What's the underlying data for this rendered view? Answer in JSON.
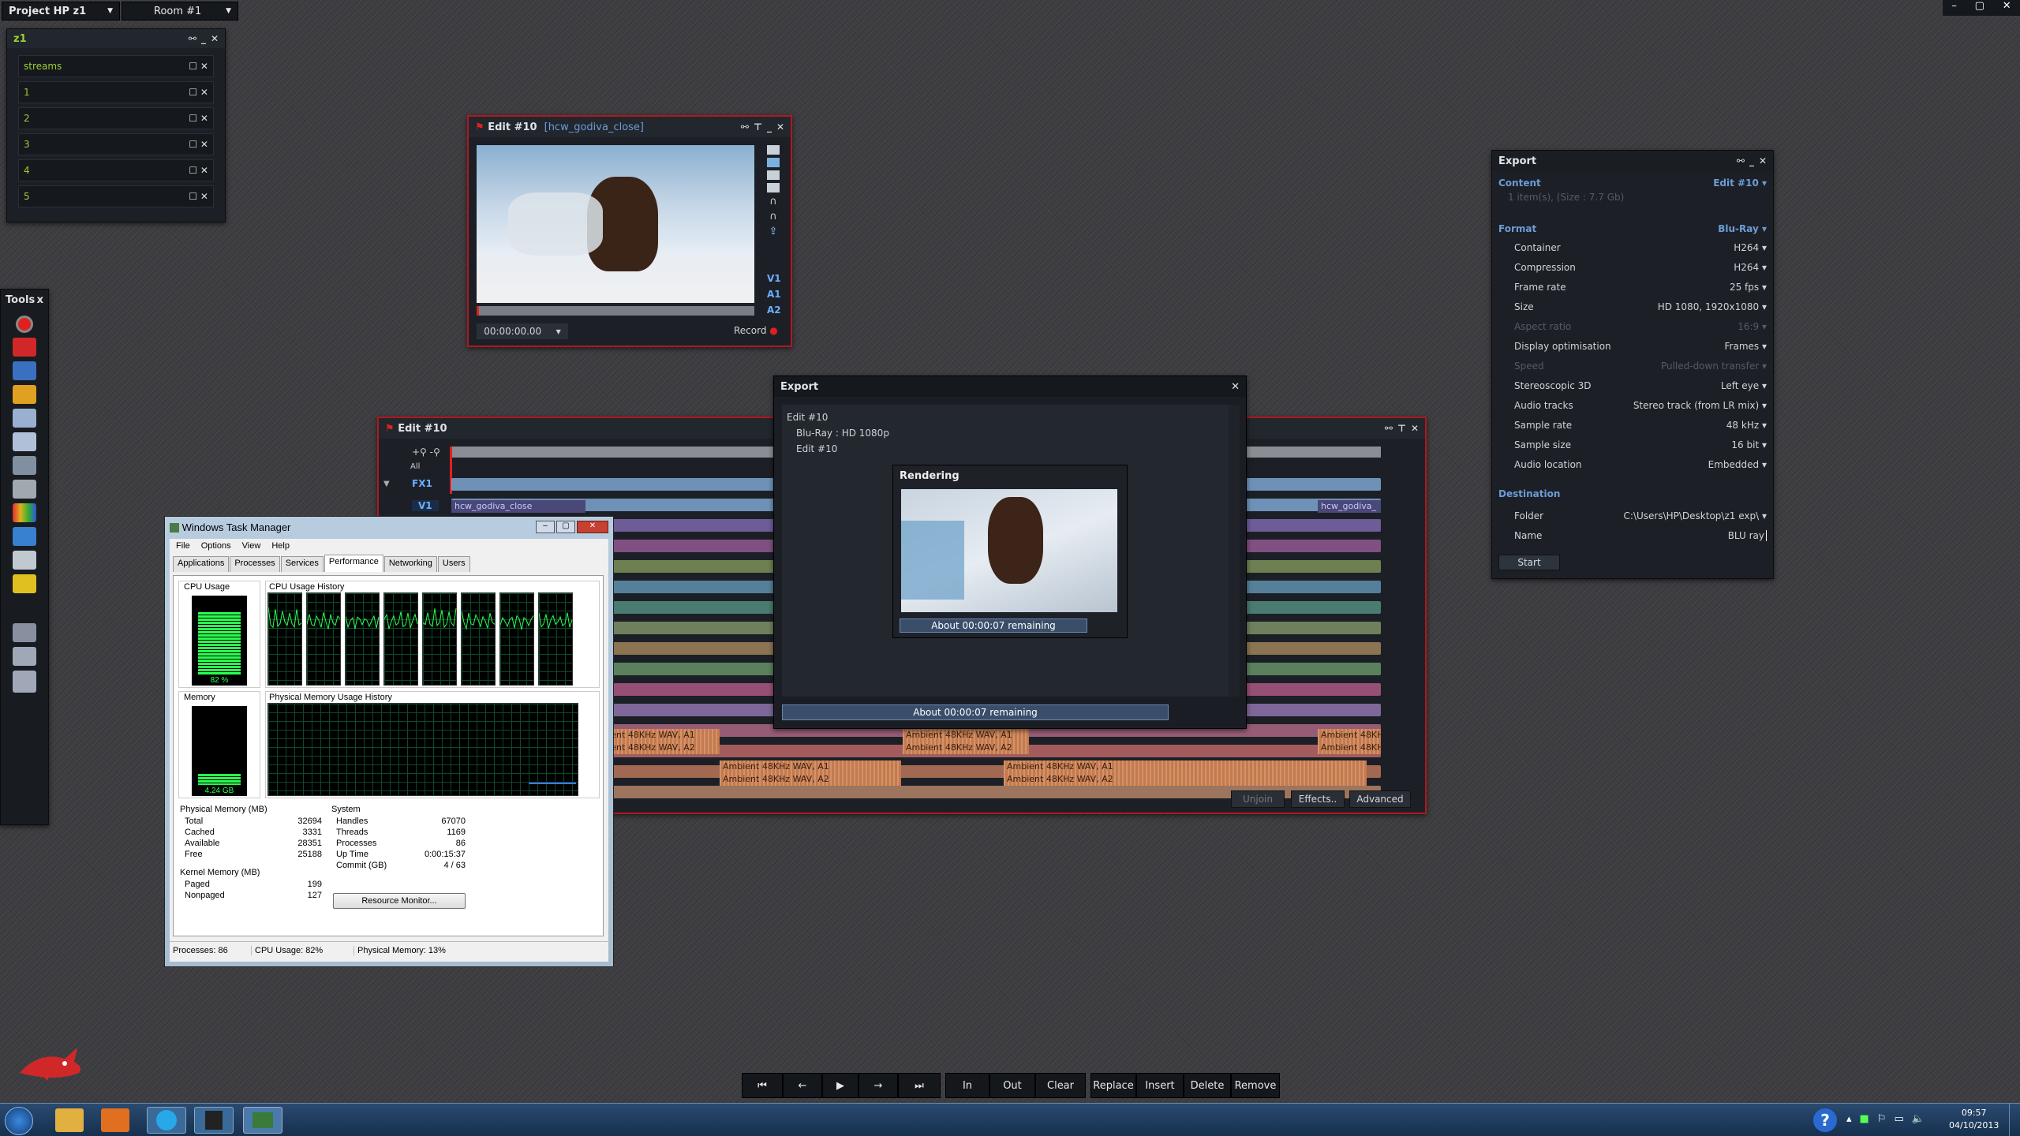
{
  "topbar": {
    "project": "Project HP z1",
    "room": "Room #1"
  },
  "streams_panel": {
    "title": "z1",
    "items": [
      "streams",
      "1",
      "2",
      "3",
      "4",
      "5"
    ]
  },
  "tools": {
    "title": "Tools"
  },
  "viewer": {
    "title": "Edit #10",
    "clip": "[hcw_godiva_close]",
    "timecode": "00:00:00.00",
    "record": "Record",
    "tracks": [
      "V1",
      "A1",
      "A2"
    ]
  },
  "timeline": {
    "title": "Edit #10",
    "all": "All",
    "fx1": "FX1",
    "v1": "V1",
    "clip_v1": "hcw_godiva_close",
    "clip_v1_right": "hcw_godiva_",
    "buttons": {
      "unjoin": "Unjoin",
      "effects": "Effects..",
      "advanced": "Advanced"
    },
    "audio_clips": [
      "Ambient 48KHz WAV, A1",
      "Ambient 48KHz WAV, A2",
      "Ambient 48KHz WAV, A1",
      "Ambient 48KHz WAV, A2",
      "Ambient 48KH",
      "Ambient 48KH",
      "Ambient 48KHz WAV, A1",
      "Ambient 48KHz WAV, A2",
      "Ambient 48KHz WAV, A1",
      "Ambient 48KHz WAV, A2"
    ]
  },
  "export_dialog": {
    "title": "Export",
    "lines": [
      "Edit #10",
      "Blu-Ray : HD 1080p",
      "Edit #10"
    ],
    "rendering_title": "Rendering",
    "remaining": "About 00:00:07 remaining",
    "remaining_bottom": "About 00:00:07 remaining"
  },
  "export_panel": {
    "title": "Export",
    "content_label": "Content",
    "content_value": "Edit #10",
    "items_info": "1 item(s), (Size : 7.7 Gb)",
    "format_label": "Format",
    "format_value": "Blu-Ray",
    "settings": [
      {
        "label": "Container",
        "value": "H264",
        "dim": false
      },
      {
        "label": "Compression",
        "value": "H264",
        "dim": false
      },
      {
        "label": "Frame rate",
        "value": "25 fps",
        "dim": false
      },
      {
        "label": "Size",
        "value": "HD 1080, 1920x1080",
        "dim": false
      },
      {
        "label": "Aspect ratio",
        "value": "16:9",
        "dim": true
      },
      {
        "label": "Display optimisation",
        "value": "Frames",
        "dim": false
      },
      {
        "label": "Speed",
        "value": "Pulled-down transfer",
        "dim": true
      },
      {
        "label": "Stereoscopic 3D",
        "value": "Left eye",
        "dim": false
      },
      {
        "label": "Audio tracks",
        "value": "Stereo track (from LR mix)",
        "dim": false
      },
      {
        "label": "Sample rate",
        "value": "48 kHz",
        "dim": false
      },
      {
        "label": "Sample size",
        "value": "16 bit",
        "dim": false
      },
      {
        "label": "Audio location",
        "value": "Embedded",
        "dim": false
      }
    ],
    "destination_label": "Destination",
    "folder_label": "Folder",
    "folder_value": "C:\\Users\\HP\\Desktop\\z1 exp\\",
    "name_label": "Name",
    "name_value": "BLU ray",
    "start": "Start"
  },
  "task_manager": {
    "title": "Windows Task Manager",
    "menu": [
      "File",
      "Options",
      "View",
      "Help"
    ],
    "tabs": [
      "Applications",
      "Processes",
      "Services",
      "Performance",
      "Networking",
      "Users"
    ],
    "cpu_usage_label": "CPU Usage",
    "cpu_usage_value": "82 %",
    "cpu_history_label": "CPU Usage History",
    "memory_label": "Memory",
    "memory_value": "4.24 GB",
    "mem_history_label": "Physical Memory Usage History",
    "phys_mem_title": "Physical Memory (MB)",
    "phys_mem": [
      [
        "Total",
        "32694"
      ],
      [
        "Cached",
        "3331"
      ],
      [
        "Available",
        "28351"
      ],
      [
        "Free",
        "25188"
      ]
    ],
    "kernel_title": "Kernel Memory (MB)",
    "kernel": [
      [
        "Paged",
        "199"
      ],
      [
        "Nonpaged",
        "127"
      ]
    ],
    "system_title": "System",
    "system": [
      [
        "Handles",
        "67070"
      ],
      [
        "Threads",
        "1169"
      ],
      [
        "Processes",
        "86"
      ],
      [
        "Up Time",
        "0:00:15:37"
      ],
      [
        "Commit (GB)",
        "4 / 63"
      ]
    ],
    "resource_btn": "Resource Monitor...",
    "status": {
      "processes": "Processes: 86",
      "cpu": "CPU Usage: 82%",
      "mem": "Physical Memory: 13%"
    },
    "cpu_fill": 0.82,
    "mem_fill": 0.13
  },
  "transport": {
    "in": "In",
    "out": "Out",
    "clear": "Clear",
    "replace": "Replace",
    "insert": "Insert",
    "delete": "Delete",
    "remove": "Remove"
  },
  "taskbar": {
    "time": "09:57",
    "date": "04/10/2013"
  }
}
